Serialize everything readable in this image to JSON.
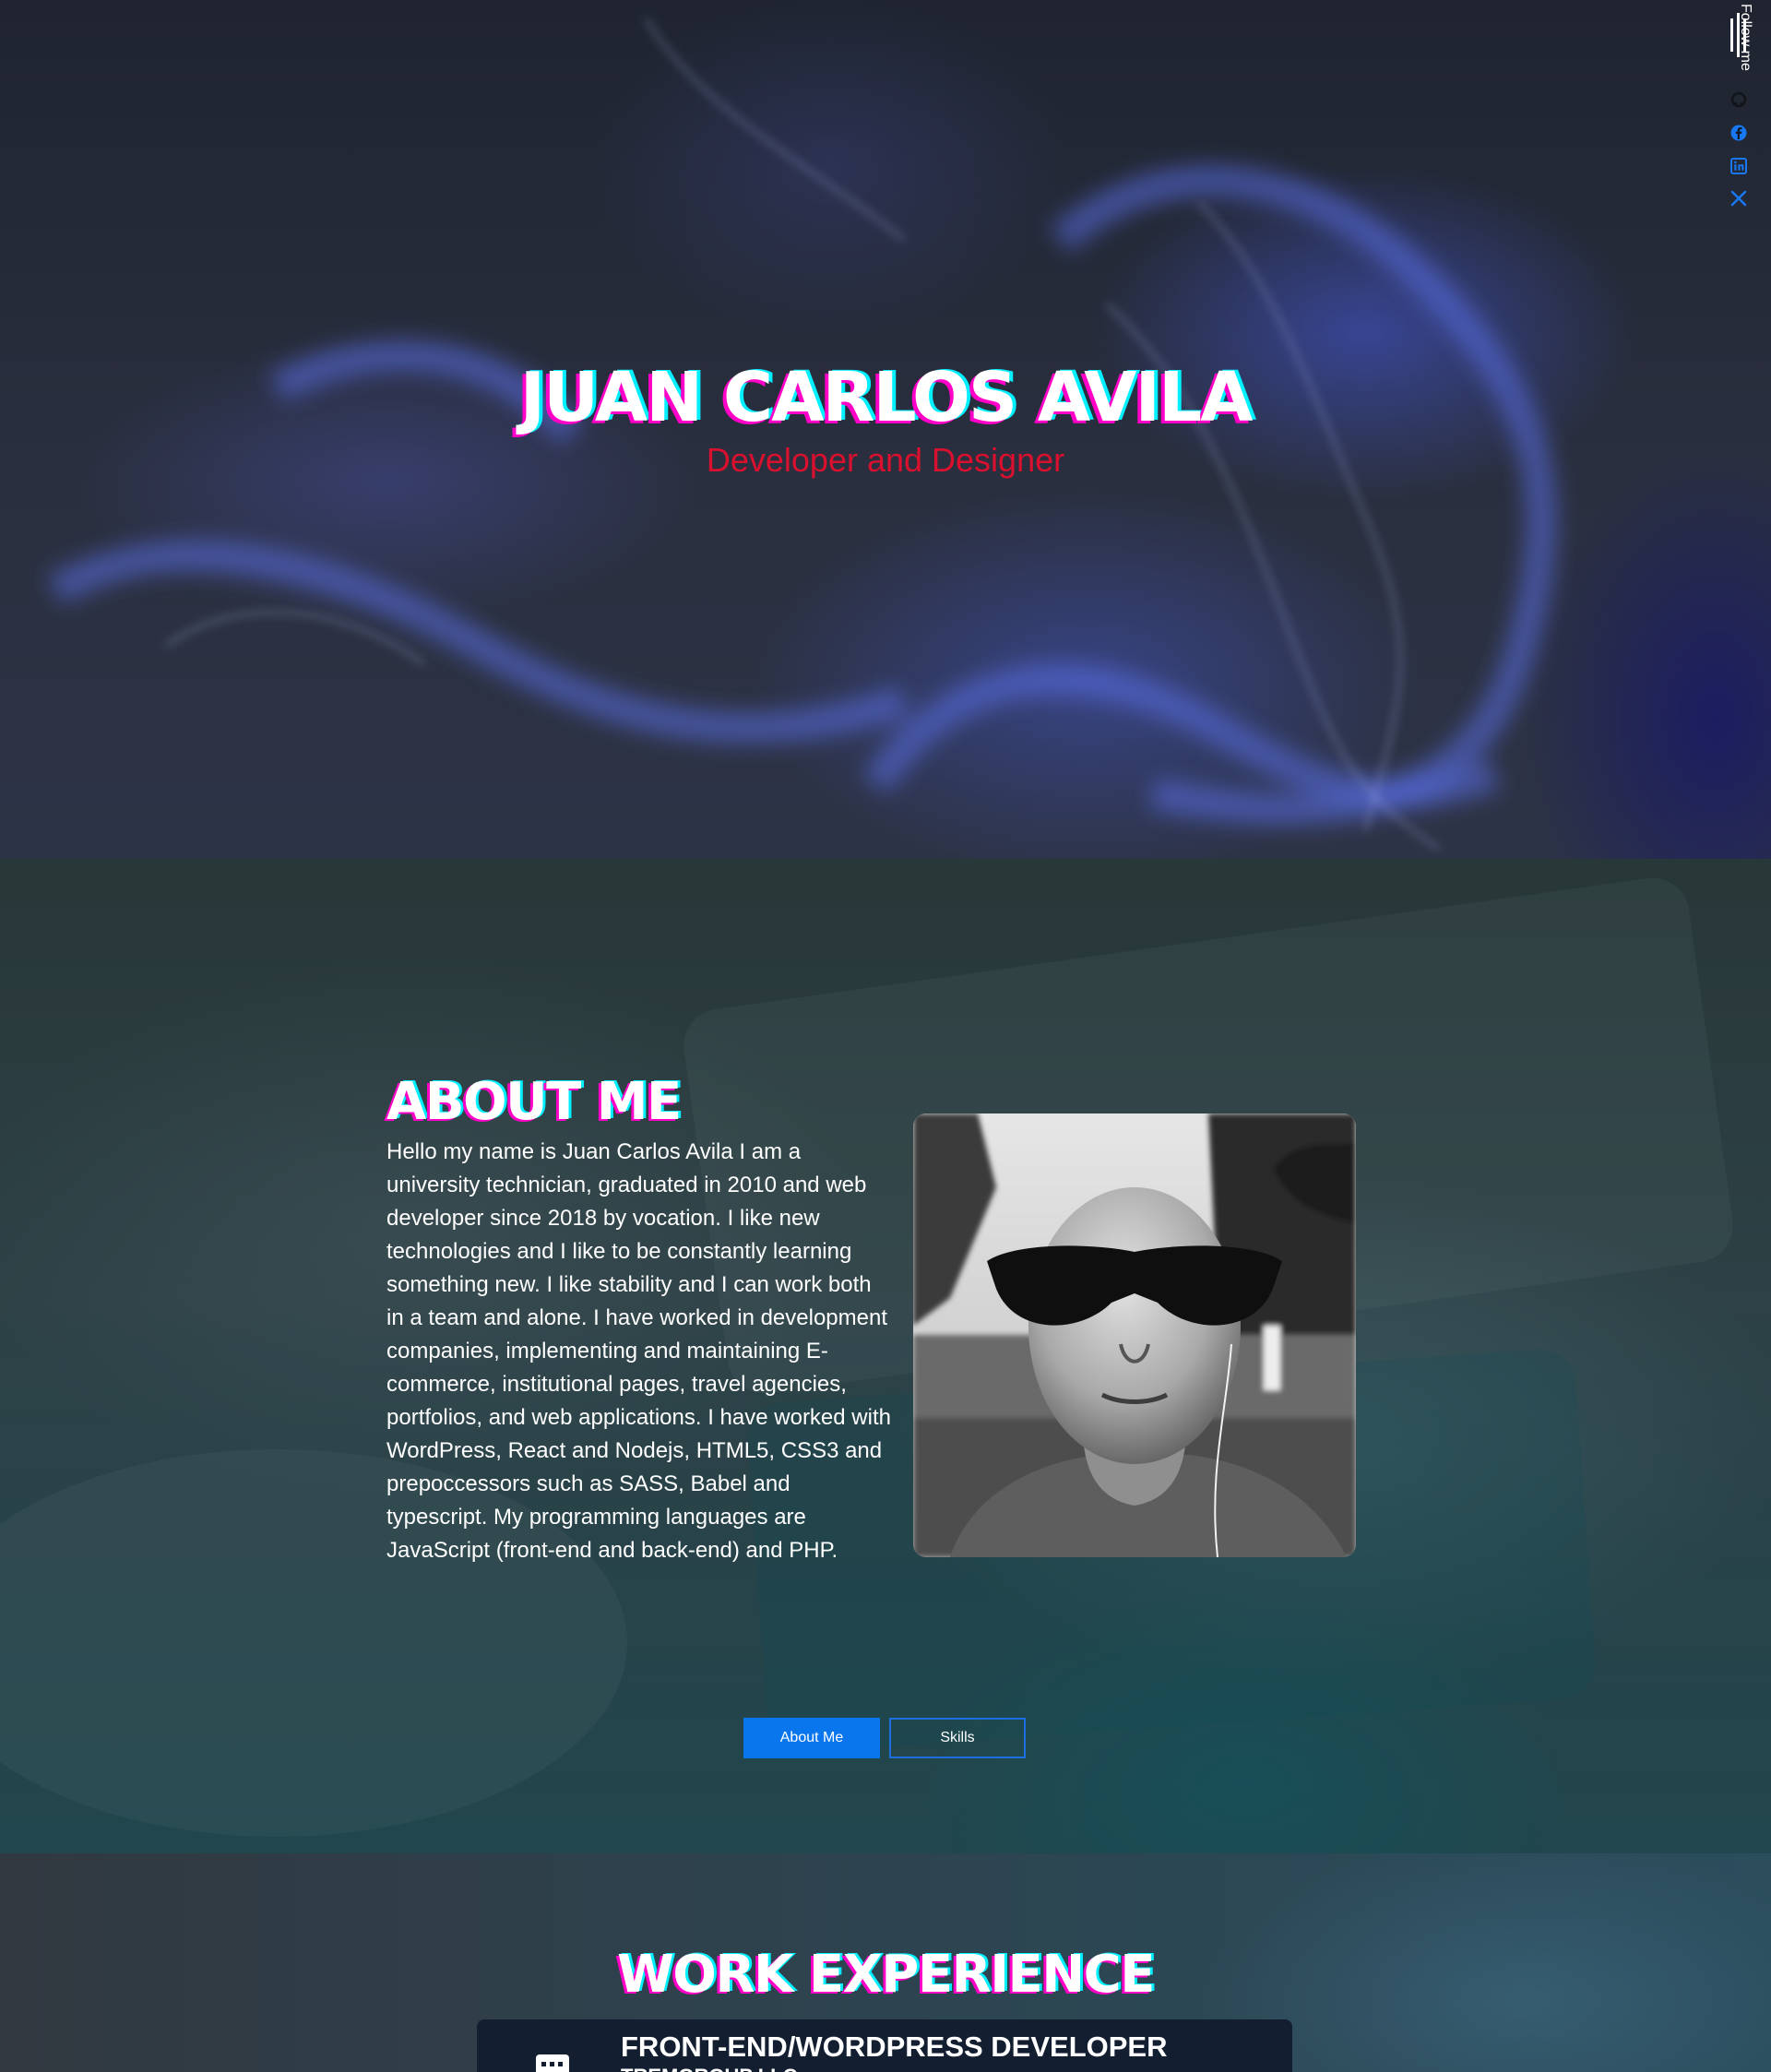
{
  "hero": {
    "title": "JUAN CARLOS AVILA",
    "subtitle": "Developer and Designer"
  },
  "social": {
    "follow_label": "Follow me",
    "icons": [
      "github-icon",
      "facebook-icon",
      "linkedin-icon",
      "x-icon"
    ]
  },
  "about": {
    "title": "ABOUT ME",
    "text": "Hello my name is Juan Carlos Avila I am a university technician, graduated in 2010 and web developer since 2018 by vocation. I like new technologies and I like to be constantly learning something new. I like stability and I can work both in a team and alone. I have worked in development companies, implementing and maintaining E-commerce, institutional pages, travel agencies, portfolios, and web applications. I have worked with WordPress, React and Nodejs, HTML5, CSS3 and prepoccessors such as SASS, Babel and typescript. My programming languages are JavaScript (front-end and back-end) and PHP.",
    "buttons": {
      "about": "About Me",
      "skills": "Skills"
    }
  },
  "work": {
    "title": "WORK EXPERIENCE",
    "jobs": [
      {
        "title": "FRONT-END/WORDPRESS DEVELOPER",
        "company": "TREMGROUP LLC"
      }
    ]
  },
  "colors": {
    "accent_blue": "#0a76ee",
    "subtitle_red": "#d9102e",
    "glitch_magenta": "#ff00c8",
    "glitch_cyan": "#00f0ff"
  }
}
